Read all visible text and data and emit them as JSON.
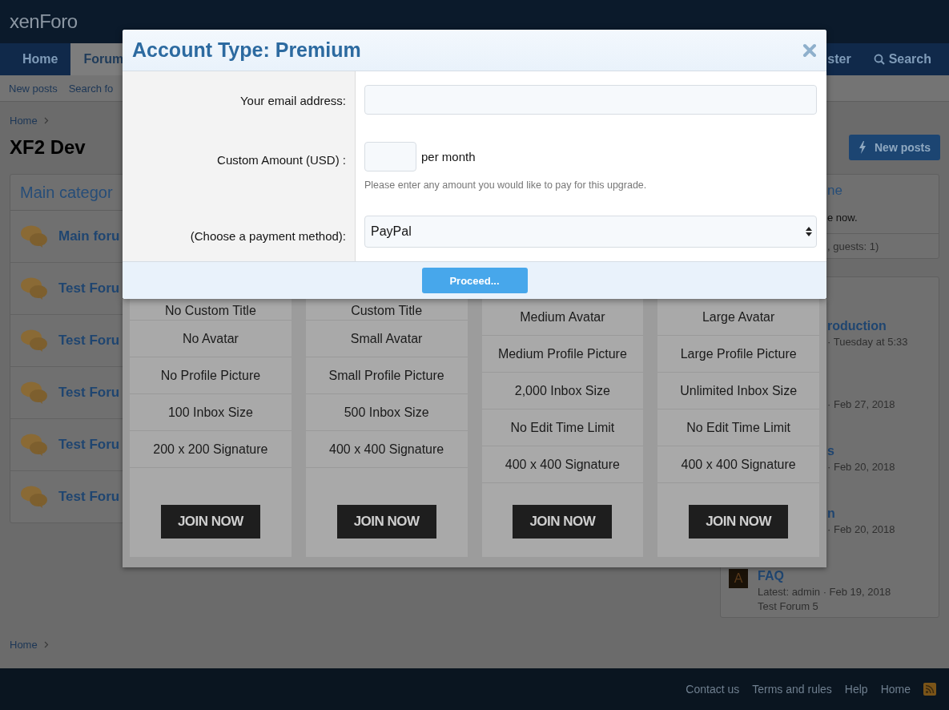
{
  "header": {
    "logo": "xenForo",
    "nav_tabs": [
      {
        "label": "Home",
        "selected": false
      },
      {
        "label": "Forum",
        "selected": true
      }
    ],
    "nav_right": [
      {
        "kind": "link",
        "label": "ster"
      },
      {
        "kind": "search",
        "label": "Search"
      }
    ]
  },
  "subnav": [
    "New posts",
    "Search fo"
  ],
  "breadcrumb": [
    "Home"
  ],
  "page_title": "XF2 Dev",
  "new_posts_button": "New posts",
  "category": {
    "title": "Main categor",
    "forums": [
      "Main foru",
      "Test Foru",
      "Test Foru",
      "Test Foru",
      "Test Foru",
      "Test Foru"
    ]
  },
  "sidebar": {
    "online": {
      "title": "ne",
      "text": "e now.",
      "stats": ", guests: 1)"
    },
    "latest": [
      {
        "title": "roduction",
        "meta": "· Tuesday at 5:33"
      },
      {
        "meta": "· Feb 27, 2018"
      },
      {
        "title": "s",
        "meta": "· Feb 20, 2018"
      },
      {
        "title": "n",
        "meta": "· Feb 20, 2018"
      },
      {
        "avatar": "A",
        "title": "FAQ",
        "meta": "Latest: admin · Feb 19, 2018",
        "forum": "Test Forum 5"
      }
    ]
  },
  "plans": [
    {
      "features": [
        "No Custom Title",
        "No Avatar",
        "No Profile Picture",
        "100 Inbox Size",
        "200 x 200 Signature"
      ],
      "button": "JOIN NOW"
    },
    {
      "features": [
        "Custom Title",
        "Small Avatar",
        "Small Profile Picture",
        "500 Inbox Size",
        "400 x 400 Signature"
      ],
      "button": "JOIN NOW"
    },
    {
      "features": [
        "Medium Avatar",
        "Medium Profile Picture",
        "2,000 Inbox Size",
        "No Edit Time Limit",
        "400 x 400 Signature"
      ],
      "button": "JOIN NOW"
    },
    {
      "features": [
        "Large Avatar",
        "Large Profile Picture",
        "Unlimited Inbox Size",
        "No Edit Time Limit",
        "400 x 400 Signature"
      ],
      "button": "JOIN NOW"
    }
  ],
  "dialog": {
    "title": "Account Type: Premium",
    "fields": [
      {
        "kind": "text",
        "label": "Your email address:"
      },
      {
        "kind": "amount",
        "label": "Custom Amount (USD) :",
        "suffix": "per month",
        "hint": "Please enter any amount you would like to pay for this upgrade."
      },
      {
        "kind": "select",
        "label": "(Choose a payment method):",
        "value": "PayPal"
      }
    ],
    "submit": "Proceed..."
  },
  "footer_breadcrumb": [
    "Home"
  ],
  "footer_links": [
    "Contact us",
    "Terms and rules",
    "Help",
    "Home"
  ]
}
